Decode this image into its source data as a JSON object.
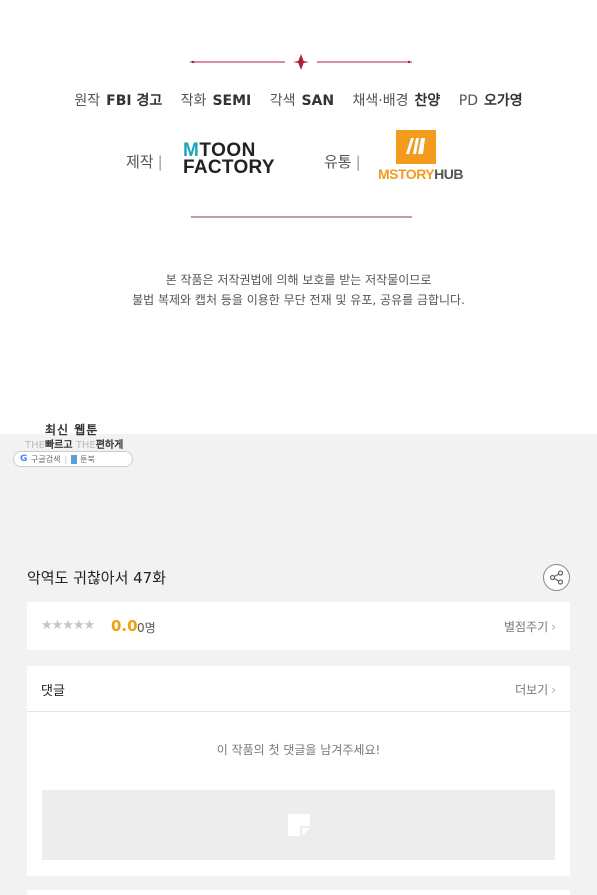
{
  "credits": {
    "staff": [
      {
        "role": "원작",
        "name": "FBI 경고"
      },
      {
        "role": "작화",
        "name": "SEMI"
      },
      {
        "role": "각색",
        "name": "SAN"
      },
      {
        "role": "채색·배경",
        "name": "찬양"
      },
      {
        "role": "PD",
        "name": "오가영"
      }
    ],
    "production_label": "제작",
    "distribution_label": "유통",
    "production_logo": {
      "line1_mark": "M",
      "line1": "TOON",
      "line2": "FACTORY"
    },
    "distribution_logo": {
      "text": "MSTORY",
      "hub": "HUB"
    },
    "copyright_line1": "본 작품은 저작권법에 의해 보호를 받는 저작물이므로",
    "copyright_line2": "불법 복제와 캡처 등을 이용한 무단 전재 및 유포, 공유를 금합니다."
  },
  "promo": {
    "title": "최신 웹툰",
    "the1": "THE",
    "faster": "빠르고",
    "the2": "THE",
    "easier": "편하게",
    "google": "구글검색",
    "bookname": "툰북"
  },
  "episode": {
    "title": "악역도 귀찮아서 47화"
  },
  "rating": {
    "stars": "★★★★★",
    "score": "0.0",
    "count": "0명",
    "action": "별점주기"
  },
  "comments": {
    "title": "댓글",
    "more": "더보기",
    "empty_message": "이 작품의 첫 댓글을 남겨주세요!"
  },
  "colors": {
    "accent": "#f0a10f",
    "ornament": "#b01c3a",
    "mtoon_teal": "#18a6b8",
    "mstory_orange": "#f29b1d"
  },
  "icons": {
    "share": "share-icon",
    "chevron": "chevron-right-icon",
    "comment_placeholder": "image-placeholder-icon"
  }
}
